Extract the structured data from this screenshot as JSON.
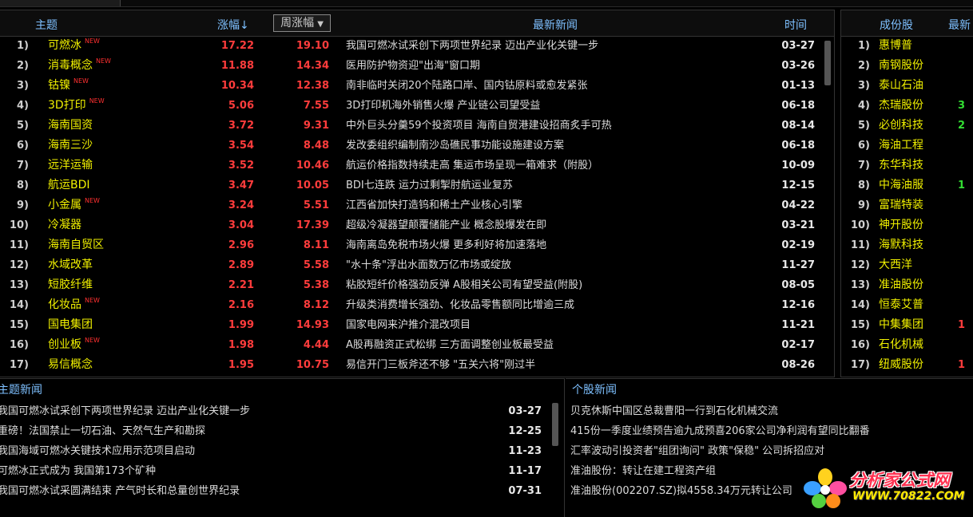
{
  "headers": {
    "topic": "主题",
    "change": "涨幅↓",
    "week_change": "周涨幅",
    "latest_news": "最新新闻",
    "time": "时间"
  },
  "side_headers": {
    "constituents": "成份股",
    "latest": "最新"
  },
  "topics": [
    {
      "idx": "1)",
      "name": "可燃冰",
      "new": true,
      "chg": "17.22",
      "wk": "19.10",
      "news": "我国可燃冰试采创下两项世界纪录 迈出产业化关键一步",
      "time": "03-27"
    },
    {
      "idx": "2)",
      "name": "消毒概念",
      "new": true,
      "chg": "11.88",
      "wk": "14.34",
      "news": "医用防护物资迎\"出海\"窗口期",
      "time": "03-26"
    },
    {
      "idx": "3)",
      "name": "钴镍",
      "new": true,
      "chg": "10.34",
      "wk": "12.38",
      "news": "南非临时关闭20个陆路口岸、国内钴原料或愈发紧张",
      "time": "01-13"
    },
    {
      "idx": "4)",
      "name": "3D打印",
      "new": true,
      "chg": "5.06",
      "wk": "7.55",
      "news": "3D打印机海外销售火爆 产业链公司望受益",
      "time": "06-18"
    },
    {
      "idx": "5)",
      "name": "海南国资",
      "new": false,
      "chg": "3.72",
      "wk": "9.31",
      "news": "中外巨头分羹59个投资项目 海南自贸港建设招商炙手可热",
      "time": "08-14"
    },
    {
      "idx": "6)",
      "name": "海南三沙",
      "new": false,
      "chg": "3.54",
      "wk": "8.48",
      "news": "发改委组织编制南沙岛礁民事功能设施建设方案",
      "time": "06-18"
    },
    {
      "idx": "7)",
      "name": "远洋运输",
      "new": false,
      "chg": "3.52",
      "wk": "10.46",
      "news": "航运价格指数持续走高 集运市场呈现一箱难求（附股）",
      "time": "10-09"
    },
    {
      "idx": "8)",
      "name": "航运BDI",
      "new": false,
      "chg": "3.47",
      "wk": "10.05",
      "news": "BDI七连跌 运力过剩掣肘航运业复苏",
      "time": "12-15"
    },
    {
      "idx": "9)",
      "name": "小金属",
      "new": true,
      "chg": "3.24",
      "wk": "5.51",
      "news": "江西省加快打造钨和稀土产业核心引擎",
      "time": "04-22"
    },
    {
      "idx": "10)",
      "name": "冷凝器",
      "new": false,
      "chg": "3.04",
      "wk": "17.39",
      "news": "超级冷凝器望颠覆储能产业 概念股爆发在即",
      "time": "03-21"
    },
    {
      "idx": "11)",
      "name": "海南自贸区",
      "new": false,
      "chg": "2.96",
      "wk": "8.11",
      "news": "海南离岛免税市场火爆 更多利好将加速落地",
      "time": "02-19"
    },
    {
      "idx": "12)",
      "name": "水域改革",
      "new": false,
      "chg": "2.89",
      "wk": "5.58",
      "news": "\"水十条\"浮出水面数万亿市场或绽放",
      "time": "11-27"
    },
    {
      "idx": "13)",
      "name": "短胶纤维",
      "new": false,
      "chg": "2.21",
      "wk": "5.38",
      "news": "粘胶短纤价格强劲反弹 A股相关公司有望受益(附股)",
      "time": "08-05"
    },
    {
      "idx": "14)",
      "name": "化妆品",
      "new": true,
      "chg": "2.16",
      "wk": "8.12",
      "news": "升级类消费增长强劲、化妆品零售额同比增逾三成",
      "time": "12-16"
    },
    {
      "idx": "15)",
      "name": "国电集团",
      "new": false,
      "chg": "1.99",
      "wk": "14.93",
      "news": "国家电网来沪推介混改项目",
      "time": "11-21"
    },
    {
      "idx": "16)",
      "name": "创业板",
      "new": true,
      "chg": "1.98",
      "wk": "4.44",
      "news": "A股再融资正式松绑 三方面调整创业板最受益",
      "time": "02-17"
    },
    {
      "idx": "17)",
      "name": "易信概念",
      "new": false,
      "chg": "1.95",
      "wk": "10.75",
      "news": "易信开门三板斧还不够 \"五关六将\"刚过半",
      "time": "08-26"
    }
  ],
  "new_badge": "NEW",
  "constituents": [
    {
      "idx": "1)",
      "name": "惠博普",
      "val": "",
      "color": "#ff3c3c"
    },
    {
      "idx": "2)",
      "name": "南钢股份",
      "val": "",
      "color": "#ff3c3c"
    },
    {
      "idx": "3)",
      "name": "泰山石油",
      "val": "",
      "color": "#ff3c3c"
    },
    {
      "idx": "4)",
      "name": "杰瑞股份",
      "val": "3",
      "color": "#33dd33"
    },
    {
      "idx": "5)",
      "name": "必创科技",
      "val": "2",
      "color": "#33dd33"
    },
    {
      "idx": "6)",
      "name": "海油工程",
      "val": "",
      "color": "#ff3c3c"
    },
    {
      "idx": "7)",
      "name": "东华科技",
      "val": "",
      "color": "#ff3c3c"
    },
    {
      "idx": "8)",
      "name": "中海油服",
      "val": "1",
      "color": "#33dd33"
    },
    {
      "idx": "9)",
      "name": "富瑞特装",
      "val": "",
      "color": "#ff3c3c"
    },
    {
      "idx": "10)",
      "name": "神开股份",
      "val": "",
      "color": "#ff3c3c"
    },
    {
      "idx": "11)",
      "name": "海默科技",
      "val": "",
      "color": "#ff3c3c"
    },
    {
      "idx": "12)",
      "name": "大西洋",
      "val": "",
      "color": "#ff3c3c"
    },
    {
      "idx": "13)",
      "name": "准油股份",
      "val": "",
      "color": "#ff3c3c"
    },
    {
      "idx": "14)",
      "name": "恒泰艾普",
      "val": "",
      "color": "#ff3c3c"
    },
    {
      "idx": "15)",
      "name": "中集集团",
      "val": "1",
      "color": "#ff3c3c"
    },
    {
      "idx": "16)",
      "name": "石化机械",
      "val": "",
      "color": "#ff3c3c"
    },
    {
      "idx": "17)",
      "name": "纽威股份",
      "val": "1",
      "color": "#ff3c3c"
    }
  ],
  "topic_news": {
    "title": "主题新闻",
    "items": [
      {
        "text": "我国可燃冰试采创下两项世界纪录 迈出产业化关键一步",
        "date": "03-27"
      },
      {
        "text": "重磅！法国禁止一切石油、天然气生产和勘探",
        "date": "12-25"
      },
      {
        "text": "我国海域可燃冰关键技术应用示范项目启动",
        "date": "11-23"
      },
      {
        "text": "可燃冰正式成为 我国第173个矿种",
        "date": "11-17"
      },
      {
        "text": "我国可燃冰试采圆满结束 产气时长和总量创世界纪录",
        "date": "07-31"
      }
    ]
  },
  "stock_news": {
    "title": "个股新闻",
    "items": [
      "贝克休斯中国区总裁曹阳一行到石化机械交流",
      "415份一季度业绩预告逾九成预喜206家公司净利润有望同比翻番",
      "汇率波动引投资者\"组团询问\" 政策\"保稳\" 公司拆招应对",
      "准油股份：转让在建工程资产组",
      "准油股份(002207.SZ)拟4558.34万元转让公司"
    ]
  },
  "watermark": {
    "brand": "分析家公式网",
    "url": "WWW.70822.COM"
  }
}
